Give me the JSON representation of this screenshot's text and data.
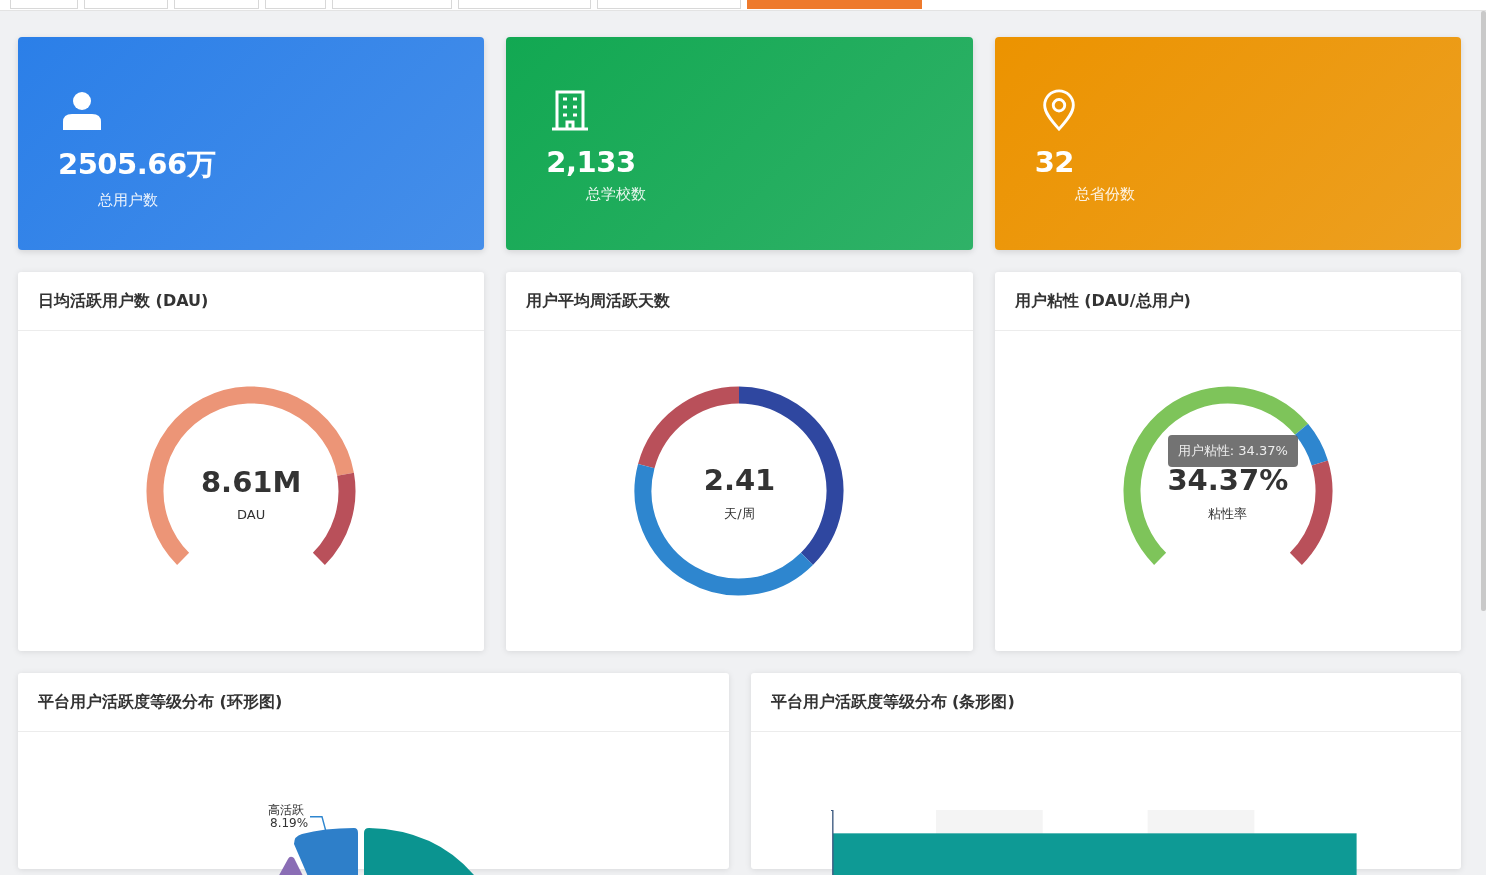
{
  "tabs": [
    {
      "selected": false
    },
    {
      "selected": false
    },
    {
      "selected": false
    },
    {
      "selected": false
    },
    {
      "selected": false
    },
    {
      "selected": false
    },
    {
      "selected": false
    },
    {
      "selected": true
    }
  ],
  "stats": [
    {
      "kind": "user",
      "value": "2505.66万",
      "label": "总用户数",
      "color": "#2b7fe8"
    },
    {
      "kind": "building",
      "value": "2,133",
      "label": "总学校数",
      "color": "#12a852"
    },
    {
      "kind": "pin",
      "value": "32",
      "label": "总省份数",
      "color": "#ec9300"
    }
  ],
  "gauges": [
    {
      "kind": "arc-dau",
      "title": "日均活跃用户数 (DAU)",
      "value": "8.61M",
      "unit": "DAU"
    },
    {
      "kind": "ring",
      "title": "用户平均周活跃天数",
      "value": "2.41",
      "unit": "天/周"
    },
    {
      "kind": "arc-sticky",
      "title": "用户粘性 (DAU/总用户)",
      "value": "34.37%",
      "unit": "粘性率",
      "tooltip": "用户粘性: 34.37%"
    }
  ],
  "bottom": [
    {
      "kind": "pie",
      "title": "平台用户活跃度等级分布 (环形图)",
      "label": "高活跃",
      "percent": "8.19%"
    },
    {
      "kind": "bar",
      "title": "平台用户活跃度等级分布 (条形图)"
    }
  ]
}
